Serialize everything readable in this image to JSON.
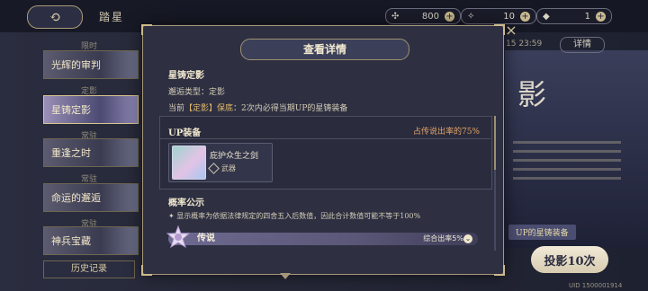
{
  "header": {
    "back_icon": "back-arrow-icon",
    "page_title": "踏星",
    "resources": [
      {
        "icon": "coin-icon",
        "value": "800"
      },
      {
        "icon": "crystal-icon",
        "value": "10"
      },
      {
        "icon": "gem-icon",
        "value": "1"
      }
    ]
  },
  "sidebar": {
    "sections": [
      {
        "heading": "限时",
        "banner": "光辉的审判"
      },
      {
        "heading": "定影",
        "banner": "星铸定影"
      },
      {
        "heading": "常驻",
        "banner": "重逢之时"
      },
      {
        "heading": "常驻",
        "banner": "命运的邂逅"
      },
      {
        "heading": "常驻",
        "banner": "神兵宝藏"
      }
    ],
    "history_label": "历史记录"
  },
  "right_panel": {
    "date": "15 23:59",
    "detail_label": "详情",
    "big_text": "影",
    "equip_label": "UP的星铸装备",
    "gacha_label": "投影10次",
    "uid": "UID 1500001914"
  },
  "modal": {
    "title": "查看详情",
    "name": "星铸定影",
    "type_line": "邂逅类型：定影",
    "guarantee_prefix": "当前",
    "guarantee_tag": "【定影】保底",
    "guarantee_suffix": "：2次内必得当期UP的星铸装备",
    "up_section": {
      "heading": "UP装备",
      "rate_text": "占传说出率的75%",
      "item": {
        "name": "庇护众生之剑",
        "type": "武器",
        "type_icon": "weapon-type-icon"
      }
    },
    "probability": {
      "heading": "概率公示",
      "note": "✦ 显示概率为依据法律规定的四舍五入后数值，因此合计数值可能不等于100%",
      "tiers": [
        {
          "label": "传说",
          "rate": "综合出率5%",
          "emblem": "legend-emblem-icon"
        }
      ]
    }
  }
}
